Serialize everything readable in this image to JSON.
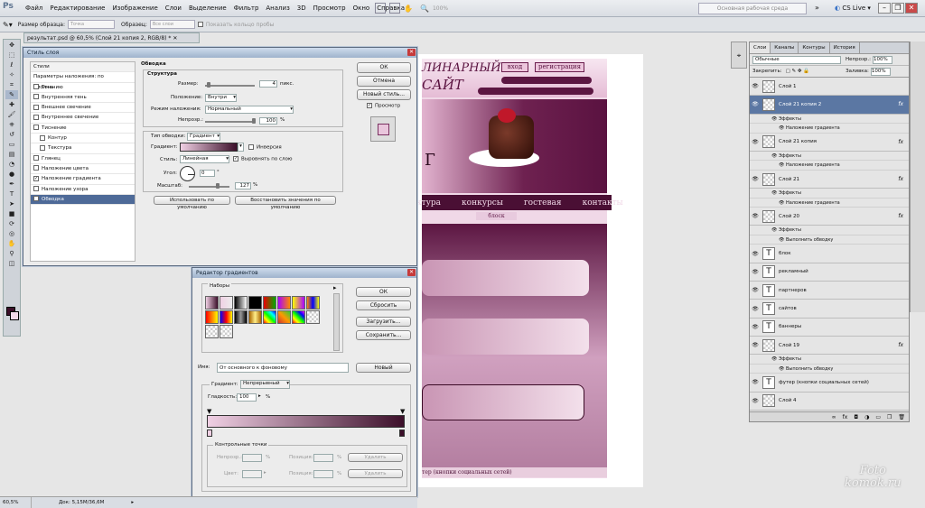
{
  "app": {
    "logo": "Ps",
    "menu": [
      "Файл",
      "Редактирование",
      "Изображение",
      "Слои",
      "Выделение",
      "Фильтр",
      "Анализ",
      "3D",
      "Просмотр",
      "Окно",
      "Справка"
    ],
    "zoom": "100%",
    "workspace": "Основная рабочая среда",
    "cslive": "CS Live"
  },
  "options": {
    "size_label": "Размер образца:",
    "size_value": "Точка",
    "sample_label": "Образец:",
    "sample_value": "Все слои",
    "show_ring": "Показать кольцо пробы"
  },
  "document": {
    "tab_title": "результат.psd @ 60,5% (Слой 21 копия 2, RGB/8) *",
    "zoom": "60,5%",
    "doc_info": "Док: 5,15M/36,6M"
  },
  "site": {
    "logo1": "ЛИНАРНЫЙ",
    "logo2": "САЙТ",
    "login": "вход",
    "register": "регистрация",
    "hero_letter": "Г",
    "nav": [
      "ктура",
      "конкурсы",
      "гостевая",
      "контакты"
    ],
    "block": "блоск",
    "footer": "тер (кнопки социальных сетей)"
  },
  "layer_style": {
    "title": "Стиль слоя",
    "styles_header": "Стили",
    "blend_defaults": "Параметры наложения: по умолчанию",
    "styles": [
      {
        "label": "Тень",
        "checked": false
      },
      {
        "label": "Внутренняя тень",
        "checked": false
      },
      {
        "label": "Внешнее свечение",
        "checked": false
      },
      {
        "label": "Внутреннее свечение",
        "checked": false
      },
      {
        "label": "Тиснение",
        "checked": false
      },
      {
        "label": "Контур",
        "checked": false,
        "sub": true
      },
      {
        "label": "Текстура",
        "checked": false,
        "sub": true
      },
      {
        "label": "Глянец",
        "checked": false
      },
      {
        "label": "Наложение цвета",
        "checked": false
      },
      {
        "label": "Наложение градиента",
        "checked": true
      },
      {
        "label": "Наложение узора",
        "checked": false
      },
      {
        "label": "Обводка",
        "checked": true,
        "active": true
      }
    ],
    "section_title": "Обводка",
    "structure": "Структура",
    "size_label": "Размер:",
    "size_value": "4",
    "size_unit": "пикс.",
    "position_label": "Положение:",
    "position_value": "Внутри",
    "blend_label": "Режим наложения:",
    "blend_value": "Нормальный",
    "opacity_label": "Непрозр.:",
    "opacity_value": "100",
    "opacity_unit": "%",
    "fill_type_label": "Тип обводки:",
    "fill_type_value": "Градиент",
    "gradient_label": "Градиент:",
    "invert": "Инверсия",
    "style_label": "Стиль:",
    "style_value": "Линейная",
    "align": "Выровнять по слою",
    "angle_label": "Угол:",
    "angle_value": "0",
    "angle_unit": "°",
    "scale_label": "Масштаб:",
    "scale_value": "127",
    "scale_unit": "%",
    "make_default": "Использовать по умолчанию",
    "reset_default": "Восстановить значения по умолчанию",
    "ok": "ОК",
    "cancel": "Отмена",
    "new_style": "Новый стиль...",
    "preview": "Просмотр"
  },
  "gradient_editor": {
    "title": "Редактор градиентов",
    "presets": "Наборы",
    "ok": "ОК",
    "reset": "Сбросить",
    "load": "Загрузить...",
    "save": "Сохранить...",
    "name_label": "Имя:",
    "name_value": "От основного к фоновому",
    "new": "Новый",
    "type_label": "Градиент:",
    "type_value": "Непрерывный",
    "smooth_label": "Гладкость:",
    "smooth_value": "100",
    "smooth_unit": "%",
    "stops_title": "Контрольные точки",
    "opacity_label": "Непрозр.:",
    "opacity_unit": "%",
    "location_label": "Позиция:",
    "location_unit": "%",
    "delete": "Удалить",
    "color_label": "Цвет:",
    "location2_label": "Позиция:",
    "location2_unit": "%",
    "delete2": "Удалить",
    "start_color": "#f0d0e4",
    "end_color": "#3c0f2a"
  },
  "layers": {
    "tabs": [
      "Слои",
      "Каналы",
      "Контуры",
      "История"
    ],
    "blend": "Обычные",
    "opacity_label": "Непрозр.:",
    "opacity_value": "100%",
    "lock_label": "Закрепить:",
    "fill_label": "Заливка:",
    "fill_value": "100%",
    "items": [
      {
        "name": "Слой 1",
        "type": "image"
      },
      {
        "name": "Слой 21 копия 2",
        "type": "image",
        "fx": "fx",
        "selected": true,
        "subs": [
          "Эффекты",
          "Наложение градиента"
        ]
      },
      {
        "name": "Слой 21 копия",
        "type": "image",
        "fx": "fx",
        "subs": [
          "Эффекты",
          "Наложение градиента"
        ]
      },
      {
        "name": "Слой 21",
        "type": "image",
        "fx": "fx",
        "subs": [
          "Эффекты",
          "Наложение градиента"
        ]
      },
      {
        "name": "Слой 20",
        "type": "image",
        "fx": "fx",
        "subs": [
          "Эффекты",
          "Выполнить обводку"
        ]
      },
      {
        "name": "блок",
        "type": "text"
      },
      {
        "name": "рекламный",
        "type": "text"
      },
      {
        "name": "партнеров",
        "type": "text"
      },
      {
        "name": "сайтов",
        "type": "text"
      },
      {
        "name": "баннеры",
        "type": "text"
      },
      {
        "name": "Слой 19",
        "type": "image",
        "fx": "fx",
        "subs": [
          "Эффекты",
          "Выполнить обводку"
        ]
      },
      {
        "name": "футер (кнопки социальных сетей)",
        "type": "text"
      },
      {
        "name": "Слой 4",
        "type": "image"
      }
    ]
  },
  "watermark": {
    "line1": "Foto",
    "line2": "komok.ru"
  }
}
